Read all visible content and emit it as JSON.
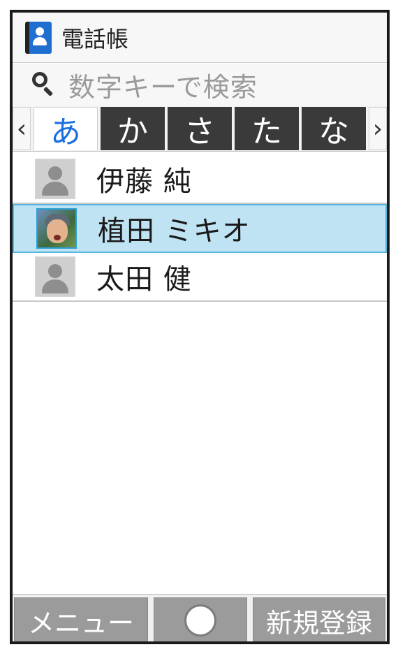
{
  "header": {
    "title": "電話帳",
    "icon": "phonebook-icon"
  },
  "search": {
    "placeholder": "数字キーで検索",
    "icon": "search-icon"
  },
  "index_tabs": {
    "prev_arrow": "‹",
    "next_arrow": "›",
    "tabs": [
      {
        "label": "あ",
        "active": true
      },
      {
        "label": "か",
        "active": false
      },
      {
        "label": "さ",
        "active": false
      },
      {
        "label": "た",
        "active": false
      },
      {
        "label": "な",
        "active": false
      }
    ]
  },
  "contacts": [
    {
      "name": "伊藤 純",
      "avatar": "default-avatar-icon",
      "selected": false
    },
    {
      "name": "植田 ミキオ",
      "avatar": "photo-avatar",
      "selected": true
    },
    {
      "name": "太田 健",
      "avatar": "default-avatar-icon",
      "selected": false
    }
  ],
  "softkeys": {
    "left": "メニュー",
    "center_icon": "circle-icon",
    "right": "新規登録"
  },
  "colors": {
    "active_tab_text": "#1a6fe0",
    "selected_row": "#bfe3f3",
    "inactive_tab_bg": "#3a3a3a",
    "softkey_bg": "#9b9b9b"
  }
}
